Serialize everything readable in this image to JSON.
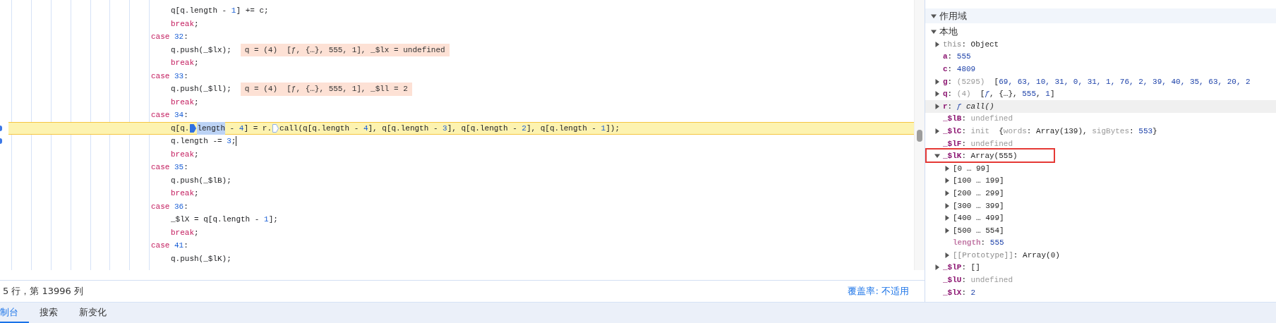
{
  "editor": {
    "lines": [
      {
        "kind": "body",
        "current": false,
        "gutter_mark": false,
        "caret": false,
        "tokens": [
          {
            "text": "q[q.length - ",
            "kind": "plain"
          },
          {
            "text": "1",
            "kind": "number"
          },
          {
            "text": "] += c;",
            "kind": "plain"
          }
        ]
      },
      {
        "kind": "body",
        "current": false,
        "gutter_mark": false,
        "caret": false,
        "tokens": [
          {
            "text": "break",
            "kind": "keyword"
          },
          {
            "text": ";",
            "kind": "plain"
          }
        ]
      },
      {
        "kind": "case",
        "current": false,
        "gutter_mark": false,
        "caret": false,
        "tokens": [
          {
            "text": "case",
            "kind": "keyword"
          },
          {
            "text": " 32",
            "kind": "number"
          },
          {
            "text": ":",
            "kind": "plain"
          }
        ]
      },
      {
        "kind": "body",
        "current": false,
        "gutter_mark": false,
        "caret": false,
        "tokens": [
          {
            "text": "q.push(_$lx);",
            "kind": "plain"
          }
        ],
        "inline_values": "q = (4)  [ƒ, {…}, 555, 1], _$lx = undefined"
      },
      {
        "kind": "body",
        "current": false,
        "gutter_mark": false,
        "caret": false,
        "tokens": [
          {
            "text": "break",
            "kind": "keyword"
          },
          {
            "text": ";",
            "kind": "plain"
          }
        ]
      },
      {
        "kind": "case",
        "current": false,
        "gutter_mark": false,
        "caret": false,
        "tokens": [
          {
            "text": "case",
            "kind": "keyword"
          },
          {
            "text": " 33",
            "kind": "number"
          },
          {
            "text": ":",
            "kind": "plain"
          }
        ]
      },
      {
        "kind": "body",
        "current": false,
        "gutter_mark": false,
        "caret": false,
        "tokens": [
          {
            "text": "q.push(_$ll);",
            "kind": "plain"
          }
        ],
        "inline_values": "q = (4)  [ƒ, {…}, 555, 1], _$ll = 2"
      },
      {
        "kind": "body",
        "current": false,
        "gutter_mark": false,
        "caret": false,
        "tokens": [
          {
            "text": "break",
            "kind": "keyword"
          },
          {
            "text": ";",
            "kind": "plain"
          }
        ]
      },
      {
        "kind": "case",
        "current": false,
        "gutter_mark": false,
        "caret": false,
        "tokens": [
          {
            "text": "case",
            "kind": "keyword"
          },
          {
            "text": " 34",
            "kind": "number"
          },
          {
            "text": ":",
            "kind": "plain"
          }
        ]
      },
      {
        "kind": "body",
        "current": true,
        "gutter_mark": true,
        "caret": false,
        "tokens": [
          {
            "text": "q[q.",
            "kind": "plain"
          },
          {
            "kind": "marker",
            "active": true
          },
          {
            "text": "length",
            "kind": "selected"
          },
          {
            "text": " - ",
            "kind": "plain"
          },
          {
            "text": "4",
            "kind": "number"
          },
          {
            "text": "] = r.",
            "kind": "plain"
          },
          {
            "kind": "marker",
            "active": false
          },
          {
            "text": "call(q[q.length - ",
            "kind": "plain"
          },
          {
            "text": "4",
            "kind": "number"
          },
          {
            "text": "], q[q.length - ",
            "kind": "plain"
          },
          {
            "text": "3",
            "kind": "number"
          },
          {
            "text": "], q[q.length - ",
            "kind": "plain"
          },
          {
            "text": "2",
            "kind": "number"
          },
          {
            "text": "], q[q.length - ",
            "kind": "plain"
          },
          {
            "text": "1",
            "kind": "number"
          },
          {
            "text": "]);",
            "kind": "plain"
          }
        ]
      },
      {
        "kind": "body",
        "current": false,
        "gutter_mark": true,
        "caret": true,
        "tokens": [
          {
            "text": "q.length -= ",
            "kind": "plain"
          },
          {
            "text": "3",
            "kind": "number"
          },
          {
            "text": ";",
            "kind": "plain"
          }
        ]
      },
      {
        "kind": "body",
        "current": false,
        "gutter_mark": false,
        "caret": false,
        "tokens": [
          {
            "text": "break",
            "kind": "keyword"
          },
          {
            "text": ";",
            "kind": "plain"
          }
        ]
      },
      {
        "kind": "case",
        "current": false,
        "gutter_mark": false,
        "caret": false,
        "tokens": [
          {
            "text": "case",
            "kind": "keyword"
          },
          {
            "text": " 35",
            "kind": "number"
          },
          {
            "text": ":",
            "kind": "plain"
          }
        ]
      },
      {
        "kind": "body",
        "current": false,
        "gutter_mark": false,
        "caret": false,
        "tokens": [
          {
            "text": "q.push(_$lB);",
            "kind": "plain"
          }
        ]
      },
      {
        "kind": "body",
        "current": false,
        "gutter_mark": false,
        "caret": false,
        "tokens": [
          {
            "text": "break",
            "kind": "keyword"
          },
          {
            "text": ";",
            "kind": "plain"
          }
        ]
      },
      {
        "kind": "case",
        "current": false,
        "gutter_mark": false,
        "caret": false,
        "tokens": [
          {
            "text": "case",
            "kind": "keyword"
          },
          {
            "text": " 36",
            "kind": "number"
          },
          {
            "text": ":",
            "kind": "plain"
          }
        ]
      },
      {
        "kind": "body",
        "current": false,
        "gutter_mark": false,
        "caret": false,
        "tokens": [
          {
            "text": "_$lX = q[q.length - ",
            "kind": "plain"
          },
          {
            "text": "1",
            "kind": "number"
          },
          {
            "text": "];",
            "kind": "plain"
          }
        ]
      },
      {
        "kind": "body",
        "current": false,
        "gutter_mark": false,
        "caret": false,
        "tokens": [
          {
            "text": "break",
            "kind": "keyword"
          },
          {
            "text": ";",
            "kind": "plain"
          }
        ]
      },
      {
        "kind": "case",
        "current": false,
        "gutter_mark": false,
        "caret": false,
        "tokens": [
          {
            "text": "case",
            "kind": "keyword"
          },
          {
            "text": " 41",
            "kind": "number"
          },
          {
            "text": ":",
            "kind": "plain"
          }
        ]
      },
      {
        "kind": "body",
        "current": false,
        "gutter_mark": false,
        "caret": false,
        "tokens": [
          {
            "text": "q.push(_$lK);",
            "kind": "plain"
          }
        ]
      }
    ]
  },
  "status_bar": {
    "position": "5 行，第 13996 列",
    "coverage": "覆盖率: 不适用"
  },
  "scope": {
    "title": "作用域",
    "expanded": true,
    "groups": [
      {
        "title": "本地",
        "expanded": true,
        "items": [
          {
            "name": "this",
            "kind": "dim",
            "expandable": true,
            "expanded": false,
            "hovered": false,
            "highlighted": false,
            "value": [
              {
                "text": ": Object",
                "kind": "plain"
              }
            ]
          },
          {
            "name": "a",
            "kind": "prop",
            "expandable": false,
            "hovered": false,
            "highlighted": false,
            "value": [
              {
                "text": ": ",
                "kind": "plain"
              },
              {
                "text": "555",
                "kind": "number"
              }
            ]
          },
          {
            "name": "c",
            "kind": "prop",
            "expandable": false,
            "hovered": false,
            "highlighted": false,
            "value": [
              {
                "text": ": ",
                "kind": "plain"
              },
              {
                "text": "4809",
                "kind": "number"
              }
            ]
          },
          {
            "name": "g",
            "kind": "prop",
            "expandable": true,
            "expanded": false,
            "hovered": false,
            "highlighted": false,
            "value": [
              {
                "text": ": ",
                "kind": "plain"
              },
              {
                "text": "(5295)",
                "kind": "dim"
              },
              {
                "text": "  [",
                "kind": "plain"
              },
              {
                "text": "69, 63, 10, 31, 0, 31, 1, 76, 2, 39, 40, 35, 63, 20, 2",
                "kind": "number"
              }
            ]
          },
          {
            "name": "q",
            "kind": "prop",
            "expandable": true,
            "expanded": false,
            "hovered": false,
            "highlighted": false,
            "value": [
              {
                "text": ": ",
                "kind": "plain"
              },
              {
                "text": "(4)",
                "kind": "dim"
              },
              {
                "text": "  [",
                "kind": "plain"
              },
              {
                "text": "ƒ",
                "kind": "func"
              },
              {
                "text": ", {…}, ",
                "kind": "plain"
              },
              {
                "text": "555",
                "kind": "number"
              },
              {
                "text": ", ",
                "kind": "plain"
              },
              {
                "text": "1",
                "kind": "number"
              },
              {
                "text": "]",
                "kind": "plain"
              }
            ]
          },
          {
            "name": "r",
            "kind": "prop",
            "expandable": true,
            "expanded": false,
            "hovered": true,
            "highlighted": false,
            "value": [
              {
                "text": ": ",
                "kind": "plain"
              },
              {
                "text": "ƒ",
                "kind": "func"
              },
              {
                "text": " call()",
                "kind": "italic"
              }
            ]
          },
          {
            "name": "_$lB",
            "kind": "prop",
            "expandable": false,
            "hovered": false,
            "highlighted": false,
            "value": [
              {
                "text": ": ",
                "kind": "plain"
              },
              {
                "text": "undefined",
                "kind": "dim"
              }
            ]
          },
          {
            "name": "_$lC",
            "kind": "prop",
            "expandable": true,
            "expanded": false,
            "hovered": false,
            "highlighted": false,
            "value": [
              {
                "text": ": ",
                "kind": "plain"
              },
              {
                "text": "init",
                "kind": "dim"
              },
              {
                "text": "  {",
                "kind": "plain"
              },
              {
                "text": "words",
                "kind": "dim"
              },
              {
                "text": ": Array(139), ",
                "kind": "plain"
              },
              {
                "text": "sigBytes",
                "kind": "dim"
              },
              {
                "text": ": ",
                "kind": "plain"
              },
              {
                "text": "553",
                "kind": "number"
              },
              {
                "text": "}",
                "kind": "plain"
              }
            ]
          },
          {
            "name": "_$lF",
            "kind": "prop",
            "expandable": false,
            "hovered": false,
            "highlighted": false,
            "value": [
              {
                "text": ": ",
                "kind": "plain"
              },
              {
                "text": "undefined",
                "kind": "dim"
              }
            ]
          },
          {
            "name": "_$lK",
            "kind": "prop",
            "expandable": true,
            "expanded": true,
            "hovered": false,
            "highlighted": true,
            "value": [
              {
                "text": ": Array(555)",
                "kind": "plain"
              }
            ],
            "children": [
              {
                "name": "[0 … 99]",
                "kind": "range",
                "expandable": true,
                "expanded": false,
                "hovered": false,
                "highlighted": false
              },
              {
                "name": "[100 … 199]",
                "kind": "range",
                "expandable": true,
                "expanded": false,
                "hovered": false,
                "highlighted": false
              },
              {
                "name": "[200 … 299]",
                "kind": "range",
                "expandable": true,
                "expanded": false,
                "hovered": false,
                "highlighted": false
              },
              {
                "name": "[300 … 399]",
                "kind": "range",
                "expandable": true,
                "expanded": false,
                "hovered": false,
                "highlighted": false
              },
              {
                "name": "[400 … 499]",
                "kind": "range",
                "expandable": true,
                "expanded": false,
                "hovered": false,
                "highlighted": false
              },
              {
                "name": "[500 … 554]",
                "kind": "range",
                "expandable": true,
                "expanded": false,
                "hovered": false,
                "highlighted": false
              },
              {
                "name": "length",
                "kind": "nonenumerable",
                "expandable": false,
                "hovered": false,
                "highlighted": false,
                "value": [
                  {
                    "text": ": ",
                    "kind": "plain"
                  },
                  {
                    "text": "555",
                    "kind": "number"
                  }
                ]
              },
              {
                "name": "[[Prototype]]",
                "kind": "dim",
                "expandable": true,
                "expanded": false,
                "hovered": false,
                "highlighted": false,
                "value": [
                  {
                    "text": ": Array(0)",
                    "kind": "plain"
                  }
                ]
              }
            ]
          },
          {
            "name": "_$lP",
            "kind": "prop",
            "expandable": true,
            "expanded": false,
            "hovered": false,
            "highlighted": false,
            "value": [
              {
                "text": ": []",
                "kind": "plain"
              }
            ]
          },
          {
            "name": "_$lU",
            "kind": "prop",
            "expandable": false,
            "hovered": false,
            "highlighted": false,
            "value": [
              {
                "text": ": ",
                "kind": "plain"
              },
              {
                "text": "undefined",
                "kind": "dim"
              }
            ]
          },
          {
            "name": "_$lX",
            "kind": "prop",
            "expandable": false,
            "hovered": false,
            "highlighted": false,
            "value": [
              {
                "text": ": ",
                "kind": "plain"
              },
              {
                "text": "2",
                "kind": "number"
              }
            ]
          }
        ]
      }
    ]
  },
  "drawer_tabs": [
    {
      "label": "制台",
      "selected": true
    },
    {
      "label": "搜索",
      "selected": false
    },
    {
      "label": "新变化",
      "selected": false
    }
  ]
}
